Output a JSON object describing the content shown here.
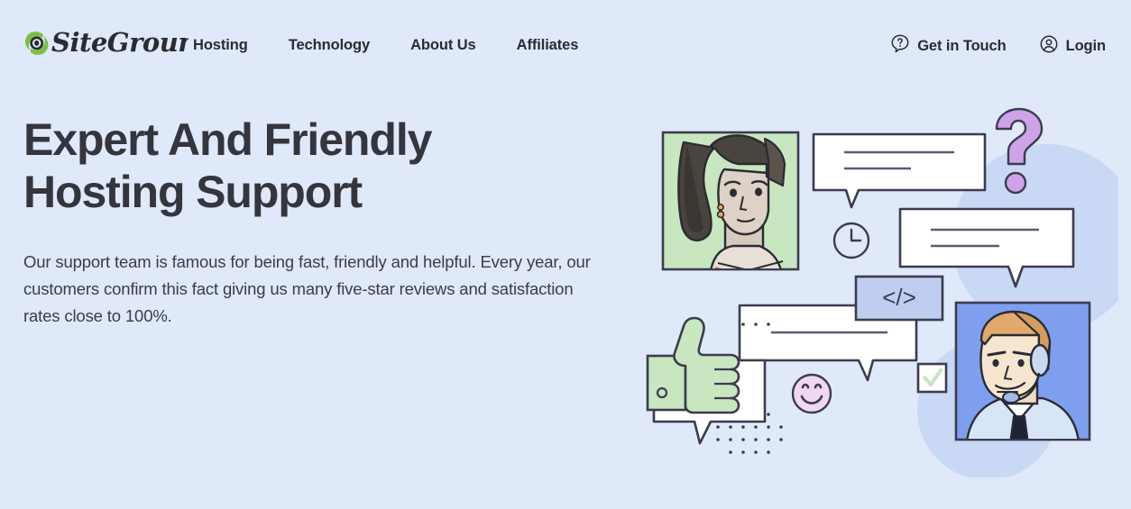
{
  "site": {
    "brand_name": "SiteGround",
    "brand_green": "#7ac143",
    "brand_dark": "#2b2b33",
    "background": "#dfe9fa"
  },
  "header": {
    "logo": {
      "icon": "siteground-swirl-logo",
      "wordmark": "SiteGround"
    },
    "nav_items": [
      {
        "label": "Hosting"
      },
      {
        "label": "Technology"
      },
      {
        "label": "About Us"
      },
      {
        "label": "Affiliates"
      }
    ],
    "actions": [
      {
        "label": "Get in Touch",
        "icon": "question-bubble-icon"
      },
      {
        "label": "Login",
        "icon": "user-circle-icon"
      }
    ]
  },
  "hero": {
    "title": "Expert And Friendly Hosting Support",
    "paragraph": "Our support team is famous for being fast, friendly and helpful. Every year, our customers confirm this fact giving us many five-star reviews and satisfaction rates close to 100%."
  },
  "illustration": {
    "alt": "Support illustration with agents, chat bubbles and feedback icons",
    "elements": [
      {
        "name": "woman-portrait",
        "description": "Woman with dark ponytail on light green background"
      },
      {
        "name": "agent-portrait",
        "description": "Male support agent with headset on blue background"
      },
      {
        "name": "chat-bubble-top",
        "description": "White speech bubble with two text lines"
      },
      {
        "name": "chat-bubble-right",
        "description": "White speech bubble with two text lines"
      },
      {
        "name": "chat-bubble-mid",
        "description": "White speech bubble with one text line"
      },
      {
        "name": "chat-bubble-bottom",
        "description": "White speech bubble behind thumbs up"
      },
      {
        "name": "question-mark",
        "description": "Purple question mark"
      },
      {
        "name": "clock-icon",
        "description": "Outlined clock showing response time"
      },
      {
        "name": "code-tag-box",
        "description": "Blue box with code brackets"
      },
      {
        "name": "thumbs-up",
        "description": "Green thumbs up hand"
      },
      {
        "name": "smiley-face",
        "description": "Pink smiley face"
      },
      {
        "name": "checkbox-check",
        "description": "Checkbox with green check mark"
      },
      {
        "name": "dot-grid",
        "description": "Decorative dot grid pattern"
      }
    ],
    "colors": {
      "green_panel": "#c8e6c0",
      "blue_panel": "#7e9fef",
      "purple": "#cfa3e8",
      "pink": "#f0d8f5",
      "code_box": "#bfcdf0",
      "soft_circle": "#c6d5f2",
      "outline": "#3c3c4e"
    },
    "code_symbol": "</>"
  }
}
